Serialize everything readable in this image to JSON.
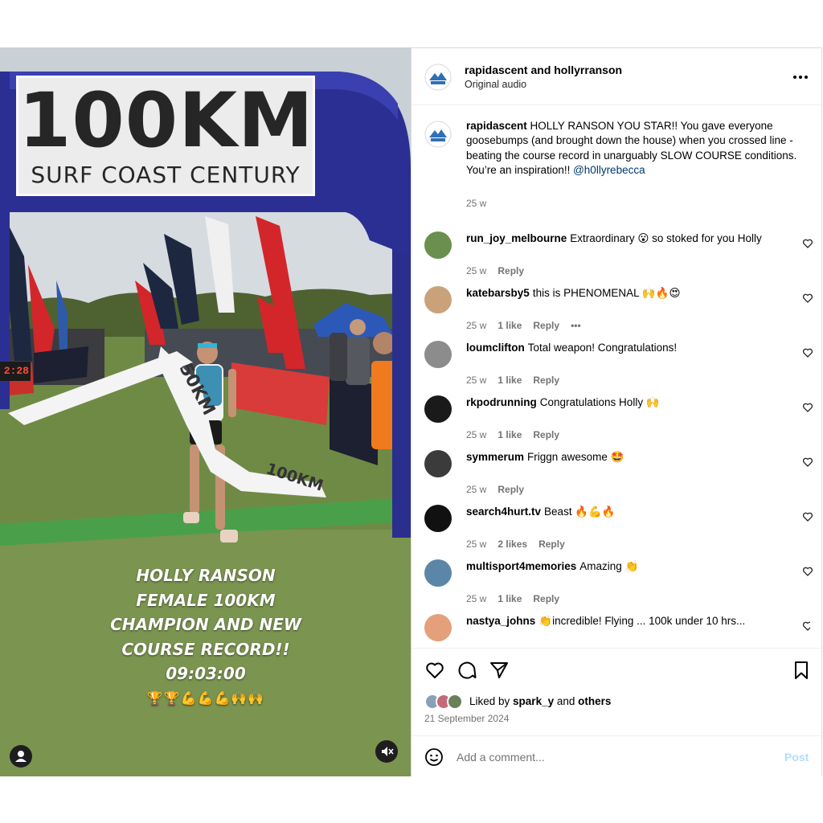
{
  "media": {
    "arch_title": "100KM",
    "arch_subtitle": "SURF COAST CENTURY",
    "clock": "2:28",
    "tape_left": "50KM",
    "tape_right": "100KM",
    "overlay": {
      "lines": [
        "HOLLY RANSON",
        "FEMALE 100KM",
        "CHAMPION AND NEW",
        "COURSE RECORD!!",
        "09:03:00"
      ],
      "emoji": "🏆🏆💪💪💪🙌🙌"
    }
  },
  "post": {
    "header": {
      "authors": "rapidascent and hollyrranson",
      "audio": "Original audio",
      "more_icon": "more-horizontal-icon"
    },
    "caption": {
      "username": "rapidascent",
      "text": "HOLLY RANSON YOU STAR!! You gave everyone goosebumps (and brought down the house) when you crossed line - beating the course record in unarguably SLOW COURSE conditions.",
      "text2": "You’re an inspiration!! ",
      "mention": "@h0llyrebecca",
      "time": "25 w"
    },
    "comments": [
      {
        "user": "run_joy_melbourne",
        "text": "Extraordinary 😮 so stoked for you Holly",
        "time": "25 w",
        "likes": "",
        "reply": "Reply",
        "more": "",
        "avatar_color": "#6b8f4e"
      },
      {
        "user": "katebarsby5",
        "text": "this is PHENOMENAL 🙌🔥😍",
        "time": "25 w",
        "likes": "1 like",
        "reply": "Reply",
        "more": "•••",
        "avatar_color": "#c9a27a"
      },
      {
        "user": "loumclifton",
        "text": "Total weapon! Congratulations!",
        "time": "25 w",
        "likes": "1 like",
        "reply": "Reply",
        "more": "",
        "avatar_color": "#8c8c8c"
      },
      {
        "user": "rkpodrunning",
        "text": "Congratulations Holly 🙌",
        "time": "25 w",
        "likes": "1 like",
        "reply": "Reply",
        "more": "",
        "avatar_color": "#1a1a1a"
      },
      {
        "user": "symmerum",
        "text": "Friggn awesome 🤩",
        "time": "25 w",
        "likes": "",
        "reply": "Reply",
        "more": "",
        "avatar_color": "#3b3b3b"
      },
      {
        "user": "search4hurt.tv",
        "text": "Beast 🔥💪🔥",
        "time": "25 w",
        "likes": "2 likes",
        "reply": "Reply",
        "more": "",
        "avatar_color": "#111111"
      },
      {
        "user": "multisport4memories",
        "text": "Amazing 👏",
        "time": "25 w",
        "likes": "1 like",
        "reply": "Reply",
        "more": "",
        "avatar_color": "#5c86a8"
      },
      {
        "user": "nastya_johns",
        "text": "👏incredible! Flying ... 100k under 10 hrs...",
        "time": "",
        "likes": "",
        "reply": "",
        "more": "",
        "avatar_color": "#e4a07a"
      }
    ],
    "actions": {
      "like_icon": "heart-icon",
      "comment_icon": "comment-icon",
      "share_icon": "share-icon",
      "save_icon": "bookmark-icon"
    },
    "likes": {
      "prefix": "Liked by ",
      "user": "spark_y",
      "middle": " and ",
      "others": "others"
    },
    "date": "21 September 2024",
    "add_comment": {
      "placeholder": "Add a comment...",
      "post_label": "Post"
    }
  }
}
